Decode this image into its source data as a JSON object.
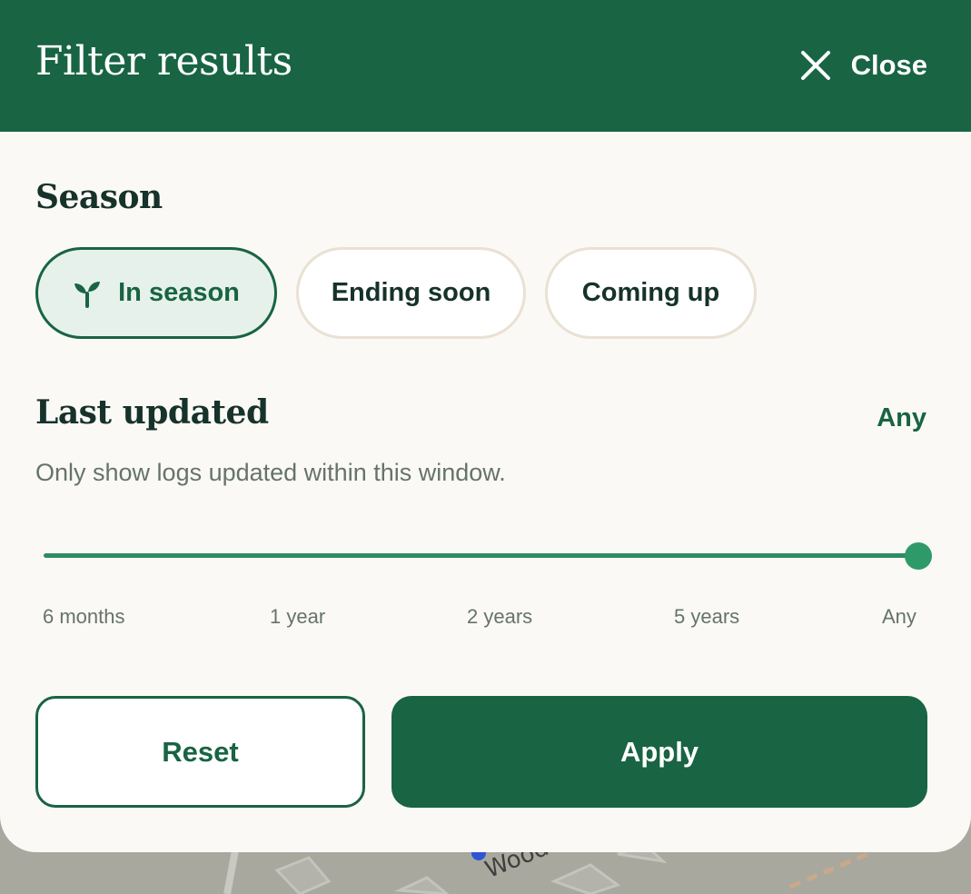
{
  "header": {
    "title": "Filter results",
    "close_label": "Close",
    "close_icon": "close-icon",
    "background": "#186443"
  },
  "season": {
    "title": "Season",
    "chips": [
      {
        "label": "In season",
        "icon": "sprout-icon",
        "selected": true
      },
      {
        "label": "Ending soon",
        "selected": false
      },
      {
        "label": "Coming up",
        "selected": false
      }
    ]
  },
  "last_updated": {
    "title": "Last updated",
    "value": "Any",
    "helper": "Only show logs updated within this window.",
    "slider": {
      "ticks": [
        "6 months",
        "1 year",
        "2 years",
        "5 years",
        "Any"
      ],
      "selected_index": 4
    }
  },
  "actions": {
    "reset_label": "Reset",
    "apply_label": "Apply"
  },
  "map": {
    "street_label": "Wood D."
  },
  "colors": {
    "brand_green": "#186443",
    "accent_green": "#2e8b62",
    "sheet_bg": "#fbf9f5",
    "chip_selected_bg": "#e7f1eb",
    "chip_border": "#e9e1d3"
  }
}
